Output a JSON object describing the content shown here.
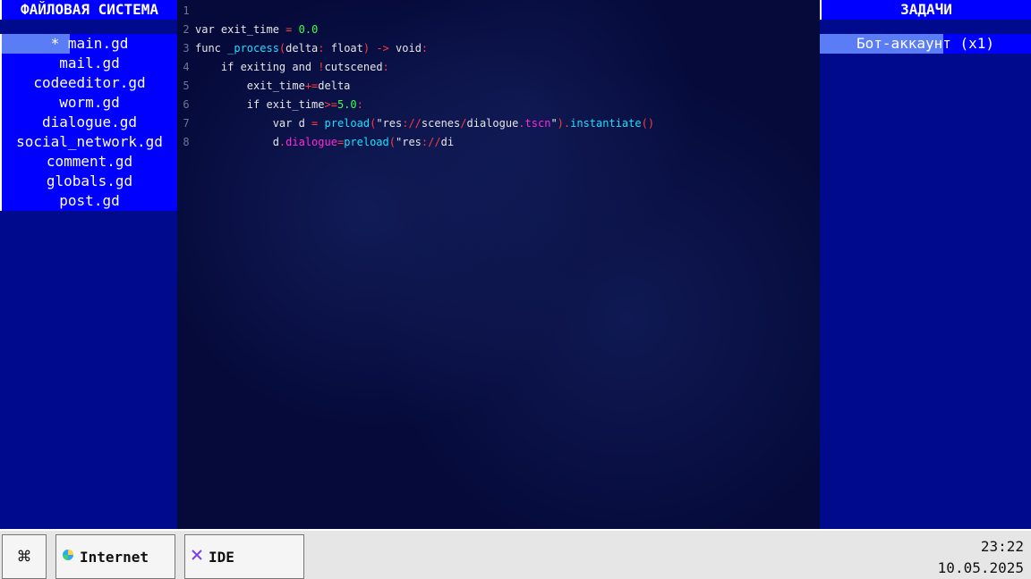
{
  "file_panel": {
    "title": "ФАЙЛОВАЯ СИСТЕМА",
    "files": [
      "* main.gd",
      "mail.gd",
      "codeeditor.gd",
      "worm.gd",
      "dialogue.gd",
      "social_network.gd",
      "comment.gd",
      "globals.gd",
      "post.gd"
    ]
  },
  "editor": {
    "lines": [
      {
        "n": "1",
        "tokens": []
      },
      {
        "n": "2",
        "tokens": [
          [
            "",
            "var exit_time "
          ],
          [
            "op",
            "="
          ],
          [
            "num",
            " 0.0"
          ]
        ]
      },
      {
        "n": "3",
        "tokens": [
          [
            "",
            "func "
          ],
          [
            "fn",
            "_process"
          ],
          [
            "op",
            "("
          ],
          [
            "",
            "delta"
          ],
          [
            "op",
            ":"
          ],
          [
            "",
            " float"
          ],
          [
            "op",
            ")"
          ],
          [
            "op",
            " ->"
          ],
          [
            "",
            " void"
          ],
          [
            "op",
            ":"
          ]
        ]
      },
      {
        "n": "4",
        "tokens": [
          [
            "",
            "    if exiting and "
          ],
          [
            "op",
            "!"
          ],
          [
            "",
            "cutscened"
          ],
          [
            "op",
            ":"
          ]
        ]
      },
      {
        "n": "5",
        "tokens": [
          [
            "",
            "        exit_time"
          ],
          [
            "op",
            "+="
          ],
          [
            "",
            "delta"
          ]
        ]
      },
      {
        "n": "6",
        "tokens": [
          [
            "",
            "        if exit_time"
          ],
          [
            "op",
            ">="
          ],
          [
            "num",
            "5.0"
          ],
          [
            "op",
            ":"
          ]
        ]
      },
      {
        "n": "7",
        "tokens": [
          [
            "",
            "            var d "
          ],
          [
            "op",
            "="
          ],
          [
            "fn",
            " preload"
          ],
          [
            "op",
            "("
          ],
          [
            "str",
            "\"res"
          ],
          [
            "op",
            "://"
          ],
          [
            "str",
            "scenes"
          ],
          [
            "op",
            "/"
          ],
          [
            "str",
            "dialogue"
          ],
          [
            "op",
            "."
          ],
          [
            "key",
            "tscn"
          ],
          [
            "str",
            "\""
          ],
          [
            "op",
            ")."
          ],
          [
            "fn",
            "instantiate"
          ],
          [
            "op",
            "()"
          ]
        ]
      },
      {
        "n": "8",
        "tokens": [
          [
            "",
            "            d"
          ],
          [
            "op",
            "."
          ],
          [
            "key",
            "dialogue"
          ],
          [
            "op",
            "="
          ],
          [
            "fn",
            "preload"
          ],
          [
            "op",
            "("
          ],
          [
            "str",
            "\"res"
          ],
          [
            "op",
            "://"
          ],
          [
            "str",
            "di"
          ]
        ]
      }
    ]
  },
  "tasks_panel": {
    "title": "ЗАДАЧИ",
    "items": [
      "Бот-аккаунт (x1)"
    ]
  },
  "taskbar": {
    "start_icon": "⌘",
    "apps": [
      {
        "label": "Internet",
        "icon": "globe-icon"
      },
      {
        "label": "IDE",
        "icon": "ide-icon"
      }
    ],
    "time": "23:22",
    "date": "10.05.2025"
  }
}
